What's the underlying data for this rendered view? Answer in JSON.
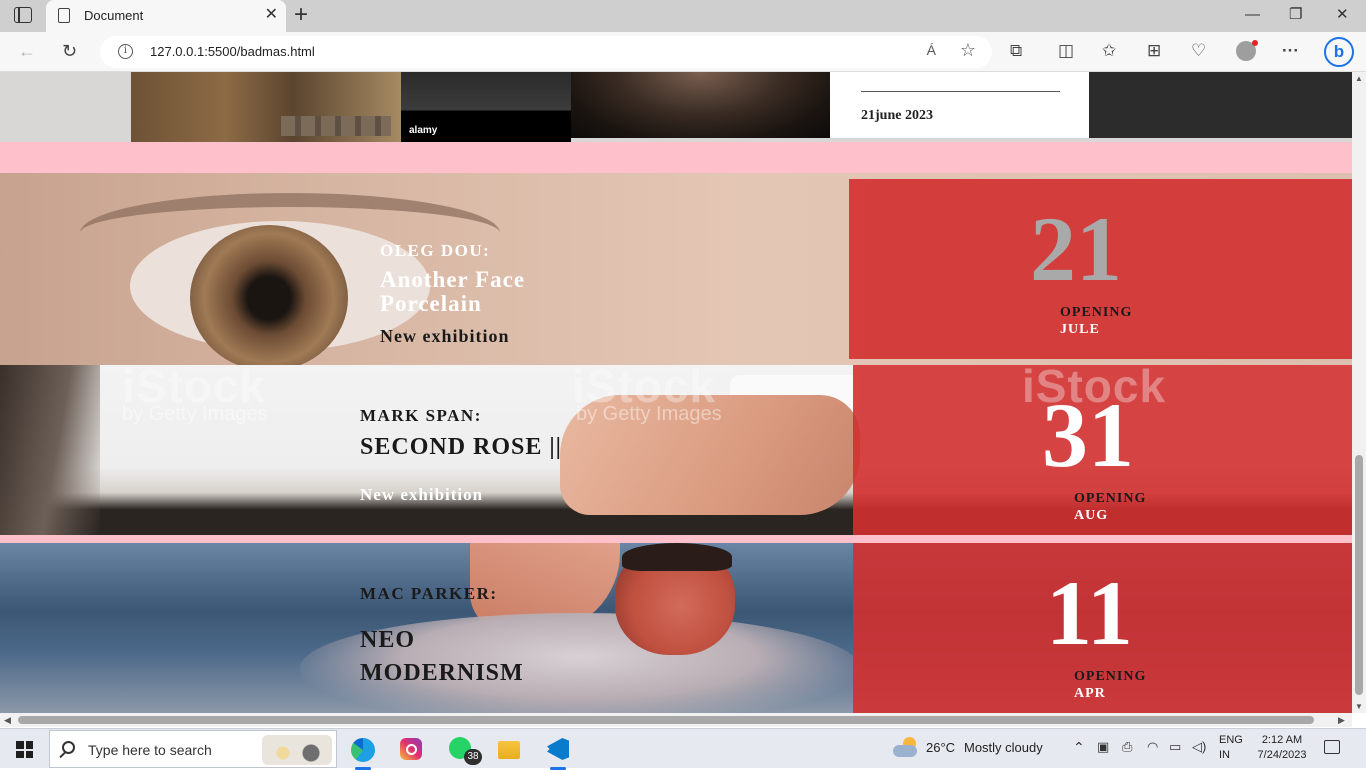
{
  "browser": {
    "tab_title": "Document",
    "tab_close": "✕",
    "new_tab": "+",
    "url": "127.0.0.1:5500/badmas.html",
    "info_glyph": "i",
    "read_aloud": "Á",
    "favorite": "☆",
    "back": "←",
    "refresh": "↻",
    "minimize": "—",
    "maximize": "❐",
    "close": "✕",
    "icons": [
      "extensions-icon",
      "split-screen-icon",
      "favorites-icon",
      "collections-icon",
      "performance-icon",
      "profile-icon",
      "more-icon",
      "bing-icon"
    ],
    "extensions": "⧉",
    "split": "◫",
    "favorites_bar": "✩",
    "collections": "⊞",
    "performance": "♡",
    "more": "···",
    "bing": "b"
  },
  "page": {
    "alamy_label": "alamy",
    "date_card_text": "21june 2023",
    "watermark_text": "iStock",
    "watermark_sub": "by Getty Images",
    "exhibits": [
      {
        "artist": "OLEG DOU:",
        "title": "Another Face Porcelain",
        "subtitle": "New exhibition",
        "day": "21",
        "opening": "OPENING",
        "month": "JULE"
      },
      {
        "artist": "MARK SPAN:",
        "title": "SECOND ROSE ||",
        "subtitle": "New exhibition",
        "day": "31",
        "opening": "OPENING",
        "month": "AUG"
      },
      {
        "artist": "MAC PARKER:",
        "title": "NEO MODERNISM",
        "subtitle": "",
        "day": "11",
        "opening": "OPENING",
        "month": "APR"
      }
    ]
  },
  "taskbar": {
    "search_placeholder": "Type here to search",
    "whatsapp_badge": "38",
    "weather_temp": "26°C",
    "weather_desc": "Mostly cloudy",
    "tray_chevron": "⌃",
    "lang_top": "ENG",
    "lang_bottom": "IN",
    "time": "2:12 AM",
    "date": "7/24/2023"
  },
  "colors": {
    "panel_red": "#d23030",
    "pink_band": "#fec0cb",
    "number_gray": "#a9a9a9",
    "number_white": "#ffffff"
  }
}
